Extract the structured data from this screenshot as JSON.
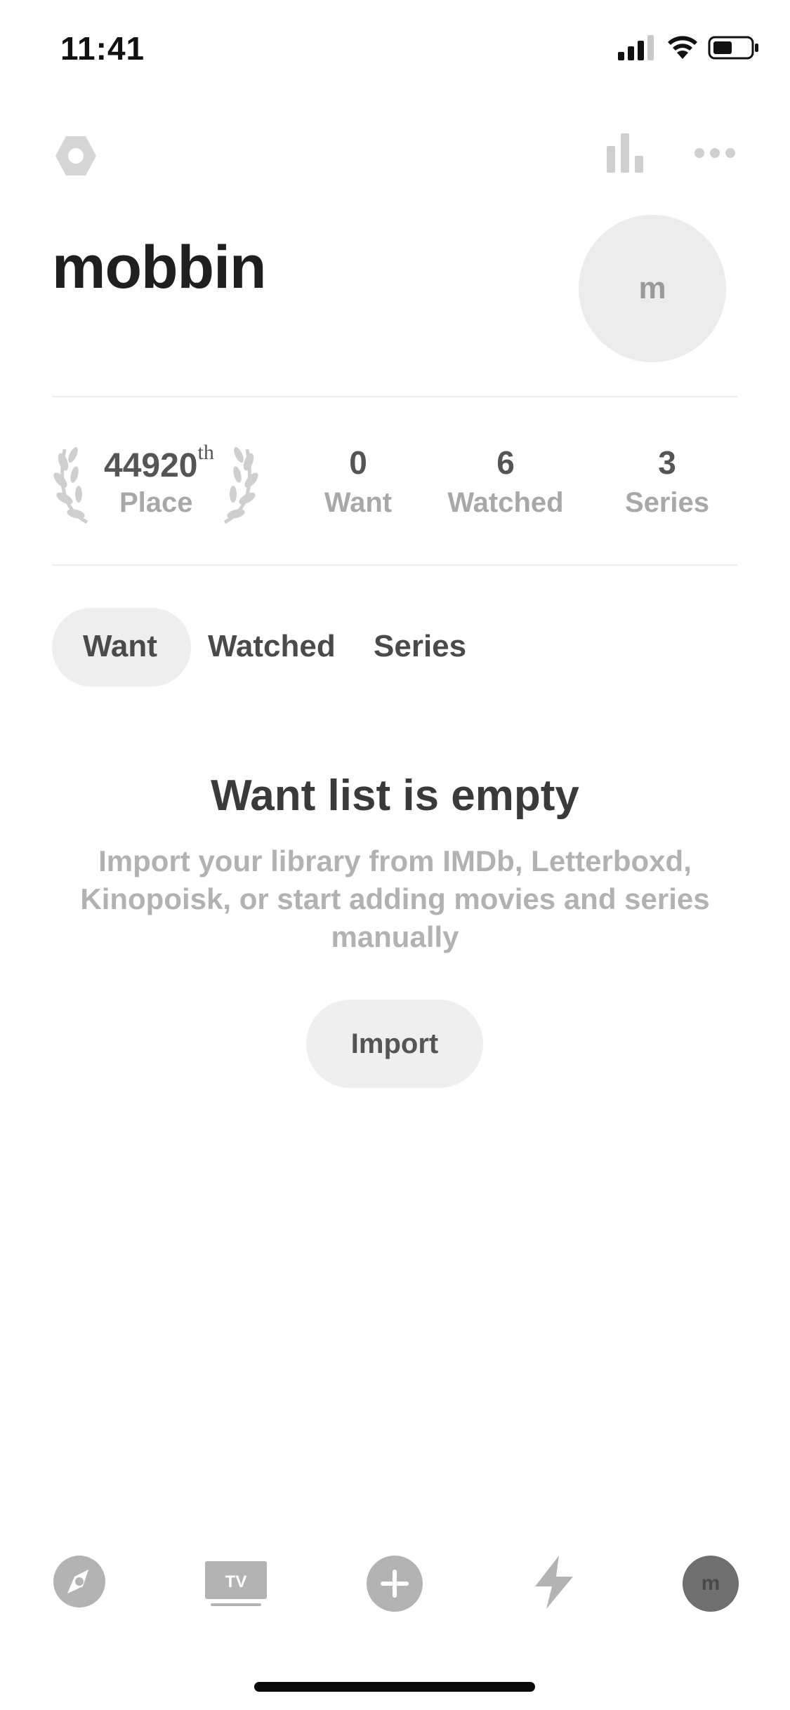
{
  "status_bar": {
    "time": "11:41"
  },
  "profile": {
    "username": "mobbin",
    "avatar_initial": "m"
  },
  "stats": {
    "rank_number": "44920",
    "rank_suffix": "th",
    "rank_label": "Place",
    "items": [
      {
        "value": "0",
        "label": "Want"
      },
      {
        "value": "6",
        "label": "Watched"
      },
      {
        "value": "3",
        "label": "Series"
      }
    ]
  },
  "tabs": [
    {
      "label": "Want",
      "selected": true
    },
    {
      "label": "Watched",
      "selected": false
    },
    {
      "label": "Series",
      "selected": false
    }
  ],
  "empty_state": {
    "title": "Want list is empty",
    "description": "Import your library from IMDb, Letterboxd, Kinopoisk, or start adding movies and series manually",
    "button": "Import"
  },
  "bottom_nav": {
    "items": [
      {
        "icon": "compass-icon"
      },
      {
        "icon": "tv-icon",
        "label": "TV"
      },
      {
        "icon": "plus-icon"
      },
      {
        "icon": "lightning-icon"
      },
      {
        "icon": "profile-avatar",
        "label": "m"
      }
    ]
  },
  "colors": {
    "text_dark": "#1f1f1f",
    "text_muted": "#a8a8a8",
    "chip_bg": "#eeeeee"
  }
}
